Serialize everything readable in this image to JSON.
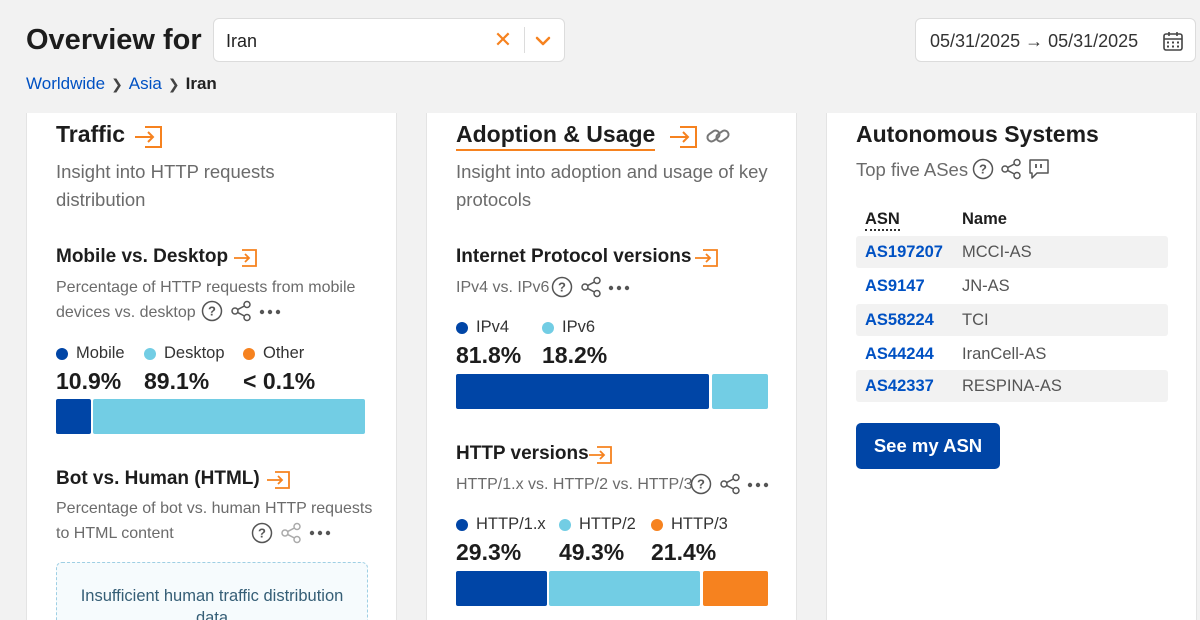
{
  "header": {
    "title": "Overview for",
    "location_value": "Iran",
    "date_range": "05/31/2025 → 05/31/2025"
  },
  "breadcrumb": {
    "items": [
      "Worldwide",
      "Asia"
    ],
    "current": "Iran"
  },
  "colors": {
    "accent": "#f6821f",
    "dark_blue": "#0045a6",
    "light_blue": "#72cde4",
    "orange": "#f6821f",
    "link": "#0051c3"
  },
  "traffic": {
    "title": "Traffic",
    "description": "Insight into HTTP requests distribution",
    "mobile_desktop": {
      "title": "Mobile vs. Desktop",
      "description": "Percentage of HTTP requests from mobile devices vs. desktop",
      "legend": [
        {
          "label": "Mobile",
          "value": "10.9%",
          "share": 10.9,
          "color": "#0045a6"
        },
        {
          "label": "Desktop",
          "value": "89.1%",
          "share": 89.1,
          "color": "#72cde4"
        },
        {
          "label": "Other",
          "value": "< 0.1%",
          "share": 0.05,
          "color": "#f6821f"
        }
      ]
    },
    "bot_human": {
      "title": "Bot vs. Human (HTML)",
      "description": "Percentage of bot vs. human HTTP requests to HTML content",
      "notice": "Insufficient human traffic distribution data"
    }
  },
  "adoption": {
    "title": "Adoption & Usage",
    "description": "Insight into adoption and usage of key protocols",
    "ip_versions": {
      "title": "Internet Protocol versions",
      "description": "IPv4 vs. IPv6",
      "legend": [
        {
          "label": "IPv4",
          "value": "81.8%",
          "share": 81.8,
          "color": "#0045a6"
        },
        {
          "label": "IPv6",
          "value": "18.2%",
          "share": 18.2,
          "color": "#72cde4"
        }
      ]
    },
    "http_versions": {
      "title": "HTTP versions",
      "description": "HTTP/1.x vs. HTTP/2 vs. HTTP/3",
      "legend": [
        {
          "label": "HTTP/1.x",
          "value": "29.3%",
          "share": 29.3,
          "color": "#0045a6"
        },
        {
          "label": "HTTP/2",
          "value": "49.3%",
          "share": 49.3,
          "color": "#72cde4"
        },
        {
          "label": "HTTP/3",
          "value": "21.4%",
          "share": 21.4,
          "color": "#f6821f"
        }
      ]
    }
  },
  "asn": {
    "title": "Autonomous Systems",
    "description": "Top five ASes",
    "columns": [
      "ASN",
      "Name"
    ],
    "rows": [
      {
        "asn": "AS197207",
        "name": "MCCI-AS"
      },
      {
        "asn": "AS9147",
        "name": "JN-AS"
      },
      {
        "asn": "AS58224",
        "name": "TCI"
      },
      {
        "asn": "AS44244",
        "name": "IranCell-AS"
      },
      {
        "asn": "AS42337",
        "name": "RESPINA-AS"
      }
    ],
    "button": "See my ASN"
  }
}
